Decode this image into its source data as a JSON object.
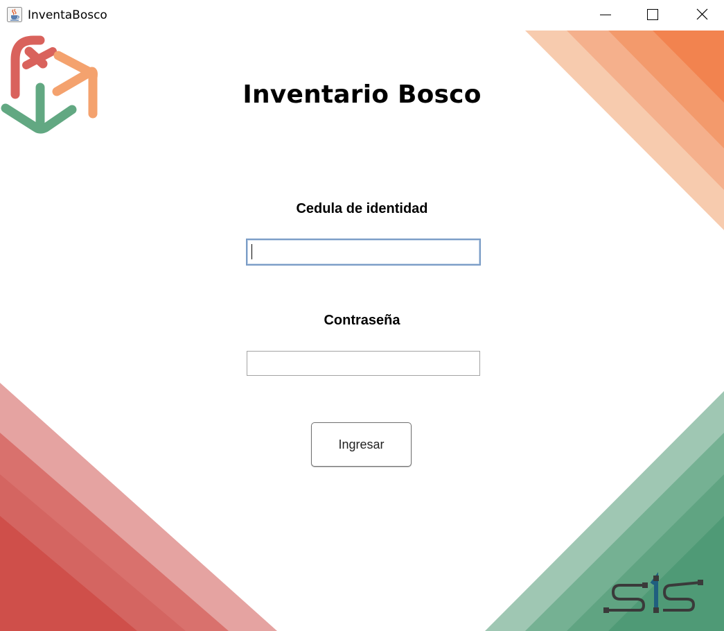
{
  "window": {
    "title": "InventaBosco",
    "app_icon": "java-cup-icon",
    "controls": [
      "minimize-icon",
      "maximize-icon",
      "close-icon"
    ]
  },
  "login": {
    "title": "Inventario Bosco",
    "cedula_label": "Cedula de identidad",
    "cedula_value": "",
    "password_label": "Contraseña",
    "password_value": "",
    "submit_label": "Ingresar"
  },
  "colors": {
    "orange": "#f2834f",
    "red": "#cf4f4a",
    "green": "#4f9a76",
    "input_focus": "#7a9cc6"
  }
}
